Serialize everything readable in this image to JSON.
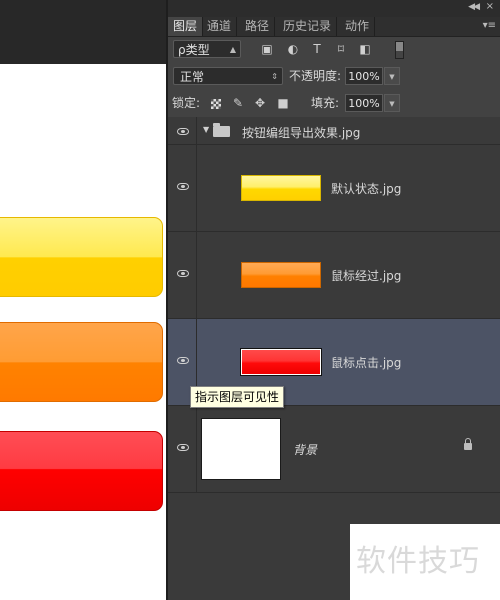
{
  "canvas": {
    "buttons": [
      {
        "state": "default",
        "color": "#ffd800"
      },
      {
        "state": "hover",
        "color": "#ff8200"
      },
      {
        "state": "click",
        "color": "#ff0000"
      }
    ]
  },
  "panel": {
    "tabs": [
      {
        "label": "图层",
        "active": true
      },
      {
        "label": "通道",
        "active": false
      },
      {
        "label": "路径",
        "active": false
      },
      {
        "label": "历史记录",
        "active": false
      },
      {
        "label": "动作",
        "active": false
      }
    ],
    "filter": {
      "kind_label": "ρ类型"
    },
    "blend": {
      "mode": "正常",
      "opacity_label": "不透明度:",
      "opacity_value": "100%",
      "lock_label": "锁定:",
      "fill_label": "填充:",
      "fill_value": "100%"
    },
    "group_name": "按钮编组导出效果.jpg",
    "layers": [
      {
        "name": "默认状态.jpg",
        "selected": false
      },
      {
        "name": "鼠标经过.jpg",
        "selected": false
      },
      {
        "name": "鼠标点击.jpg",
        "selected": true
      },
      {
        "name": "背景",
        "selected": false,
        "locked": true
      }
    ],
    "selection_color": "#4c5365"
  },
  "tooltip": {
    "text": "指示图层可见性"
  },
  "watermark": {
    "text": "软件技巧"
  }
}
